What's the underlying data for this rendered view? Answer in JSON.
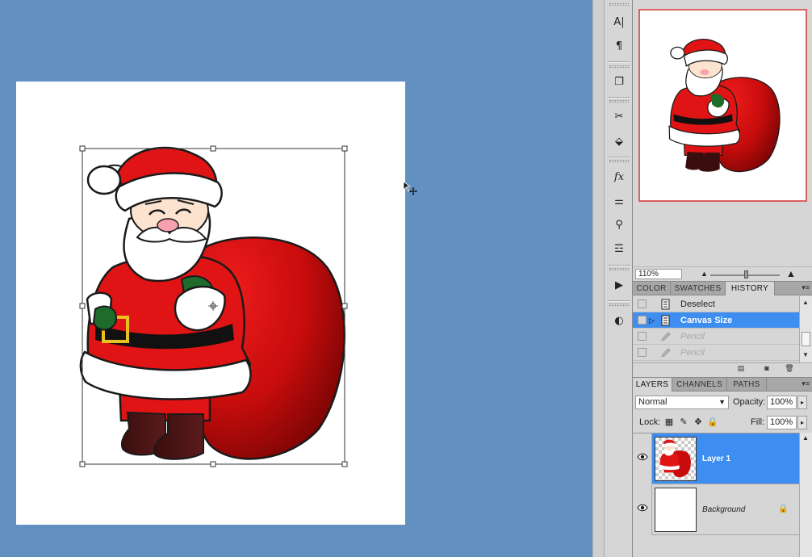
{
  "canvas": {
    "background_color": "#6290c1",
    "document_color": "#ffffff",
    "artwork": "santa-claus-with-sack",
    "cursor": "move-cursor"
  },
  "tools": [
    {
      "name": "character-icon",
      "glyph": "A|"
    },
    {
      "name": "paragraph-icon",
      "glyph": "¶"
    },
    {
      "name": "clone-source-icon",
      "glyph": "❐"
    },
    {
      "name": "tool-presets-icon",
      "glyph": "✂"
    },
    {
      "name": "3d-icon",
      "glyph": "⬙"
    },
    {
      "name": "styles-icon",
      "glyph": "fx"
    },
    {
      "name": "adjustments-icon",
      "glyph": "⚌"
    },
    {
      "name": "brushes-icon",
      "glyph": "⚲"
    },
    {
      "name": "masks-icon",
      "glyph": "☲"
    },
    {
      "name": "actions-icon",
      "glyph": "▶"
    },
    {
      "name": "mask-icon",
      "glyph": "◐"
    }
  ],
  "navigator": {
    "zoom": "110%",
    "border_color": "#d9625f"
  },
  "history_panel": {
    "tabs": [
      "COLOR",
      "SWATCHES",
      "HISTORY"
    ],
    "active_tab": "HISTORY",
    "items": [
      {
        "label": "Deselect",
        "state": "normal"
      },
      {
        "label": "Canvas Size",
        "state": "selected"
      },
      {
        "label": "Pencil",
        "state": "dim"
      },
      {
        "label": "Pencil",
        "state": "dim"
      }
    ]
  },
  "layers_panel": {
    "tabs": [
      "LAYERS",
      "CHANNELS",
      "PATHS"
    ],
    "active_tab": "LAYERS",
    "blend_mode": "Normal",
    "opacity_label": "Opacity:",
    "opacity": "100%",
    "lock_label": "Lock:",
    "fill_label": "Fill:",
    "fill": "100%",
    "layers": [
      {
        "name": "Layer 1",
        "selected": true
      },
      {
        "name": "Background",
        "selected": false,
        "locked": true
      }
    ]
  },
  "colors": {
    "selection_blue": "#3d8ef0",
    "santa_red": "#e01414"
  }
}
